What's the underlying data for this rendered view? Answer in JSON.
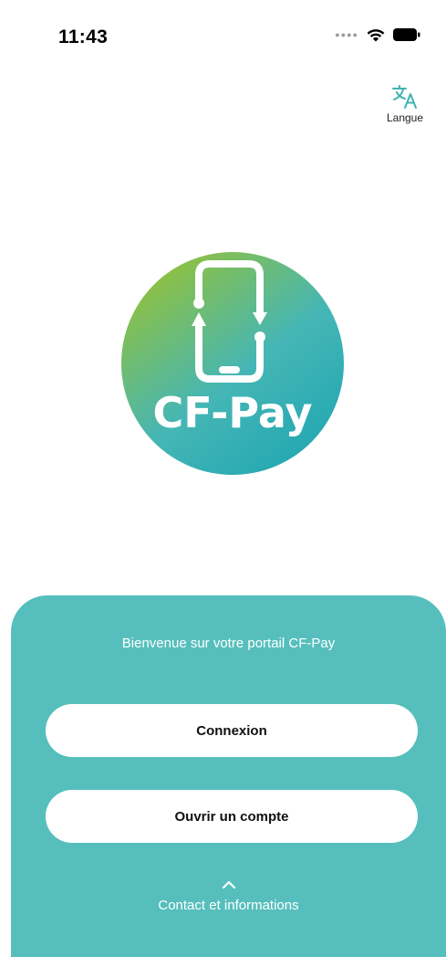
{
  "status_bar": {
    "time": "11:43",
    "signal_icon": "signal-dots-icon",
    "wifi_icon": "wifi-icon",
    "battery_icon": "battery-icon"
  },
  "language": {
    "label": "Langue",
    "icon": "translate-icon",
    "accent_color": "#3fb4b3"
  },
  "logo": {
    "text": "CF-Pay",
    "icon": "phone-transfer-icon",
    "gradient": [
      "#93c13a",
      "#45b6b5",
      "#22a7b2"
    ]
  },
  "panel": {
    "color": "#56bfbd",
    "welcome_text": "Bienvenue sur votre portail CF-Pay",
    "login_label": "Connexion",
    "open_account_label": "Ouvrir un compte",
    "contact_label": "Contact et informations",
    "contact_icon": "chevron-up-icon"
  }
}
